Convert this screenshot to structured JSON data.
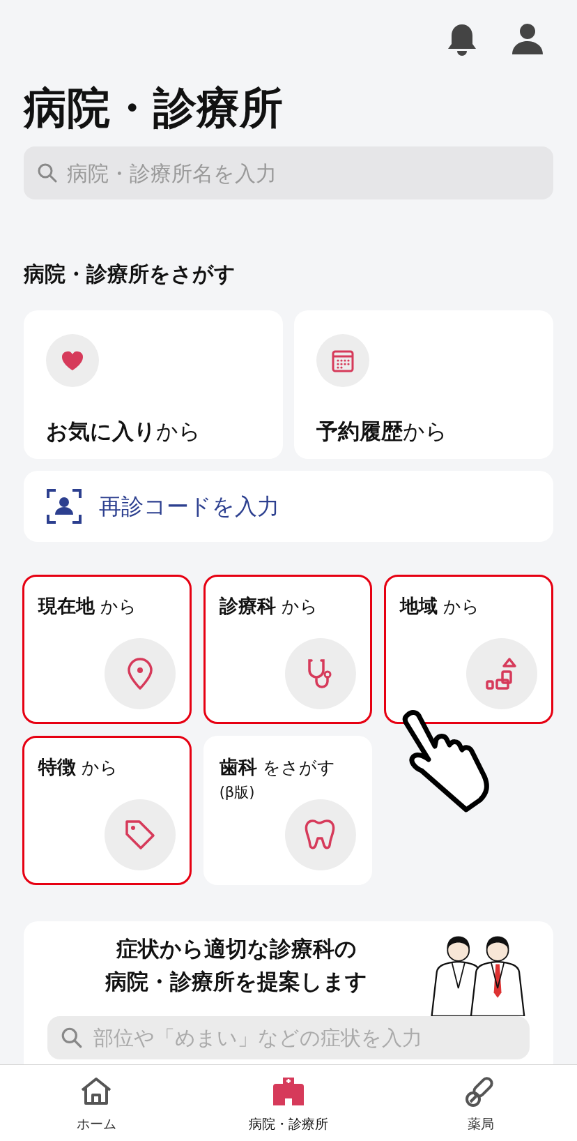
{
  "title": "病院・診療所",
  "search": {
    "placeholder": "病院・診療所名を入力"
  },
  "section_heading": "病院・診療所をさがす",
  "shortcut_cards": [
    {
      "kind": "favorite",
      "title": "お気に入り",
      "suffix": "から"
    },
    {
      "kind": "history",
      "title": "予約履歴",
      "suffix": "から"
    }
  ],
  "revisit_code": {
    "label": "再診コードを入力"
  },
  "tiles": [
    {
      "kind": "location",
      "title": "現在地",
      "suffix": "から",
      "highlighted": true
    },
    {
      "kind": "department",
      "title": "診療科",
      "suffix": "から",
      "highlighted": true
    },
    {
      "kind": "region",
      "title": "地域",
      "suffix": "から",
      "highlighted": true
    },
    {
      "kind": "feature",
      "title": "特徴",
      "suffix": "から",
      "highlighted": true
    },
    {
      "kind": "dental",
      "title": "歯科",
      "suffix": "をさがす",
      "note": "(β版)",
      "highlighted": false
    }
  ],
  "symptom_card": {
    "lines": [
      "症状から適切な診療科の",
      "病院・診療所を提案します"
    ],
    "placeholder": "部位や「めまい」などの症状を入力"
  },
  "bottom_nav": [
    {
      "kind": "home",
      "label": "ホーム",
      "selected": false
    },
    {
      "kind": "hospital",
      "label": "病院・診療所",
      "selected": true
    },
    {
      "kind": "pharmacy",
      "label": "薬局",
      "selected": false
    }
  ]
}
